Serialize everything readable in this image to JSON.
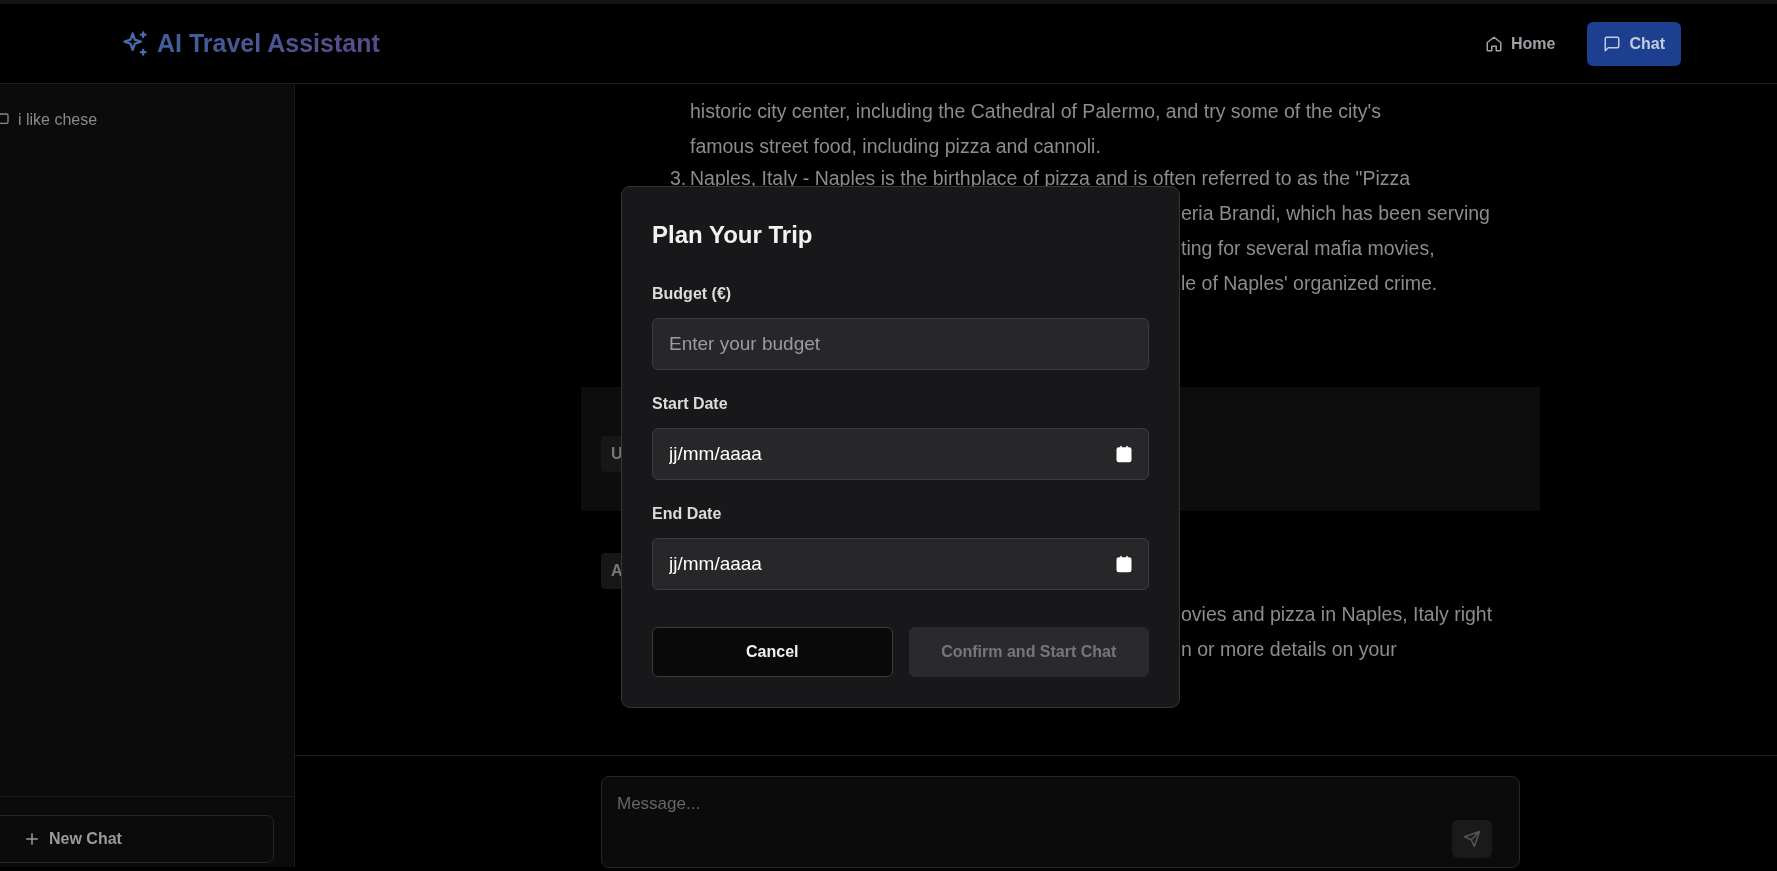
{
  "header": {
    "logo": "AI Travel Assistant",
    "nav": [
      {
        "label": "Home",
        "selected": false
      },
      {
        "label": "Chat",
        "selected": true
      }
    ]
  },
  "sidebar": {
    "chats": [
      {
        "title": "i like chese"
      }
    ],
    "new_chat": "New Chat"
  },
  "conversation": {
    "assistant_top": {
      "lines": [
        "historic city center, including the Cathedral of Palermo, and try some of the city's",
        "famous street food, including pizza and cannoli."
      ],
      "list_item": {
        "marker": "3.",
        "text": "Naples, Italy - Naples is the birthplace of pizza and is often referred to as the \"Pizza"
      },
      "fragments": [
        "eria Brandi, which has been serving",
        "ting for several mafia movies,",
        "le of Naples' organized crime."
      ]
    },
    "user_message": {
      "chip": "U"
    },
    "assistant_bottom": {
      "chip": "A",
      "fragments": [
        "ovies and pizza in Naples, Italy right",
        "n or more details on your"
      ]
    }
  },
  "composer": {
    "placeholder": "Message..."
  },
  "modal": {
    "title": "Plan Your Trip",
    "fields": [
      {
        "kind": "number",
        "label": "Budget (€)",
        "placeholder": "Enter your budget"
      },
      {
        "kind": "date",
        "label": "Start Date",
        "value": "jj/mm/aaaa"
      },
      {
        "kind": "date",
        "label": "End Date",
        "value": "jj/mm/aaaa"
      }
    ],
    "buttons": [
      {
        "label": "Cancel",
        "disabled": false
      },
      {
        "label": "Confirm and Start Chat",
        "disabled": true
      }
    ]
  }
}
